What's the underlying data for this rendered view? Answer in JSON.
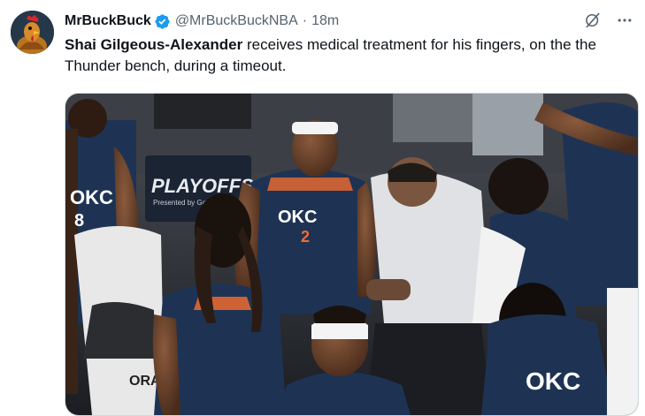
{
  "tweet": {
    "display_name": "MrBuckBuck",
    "handle": "@MrBuckBuckNBA",
    "separator": "·",
    "time": "18m",
    "text_bold": "Shai Gilgeous-Alexander",
    "text_rest": " receives medical treatment for his fingers, on the the Thunder bench, during a timeout."
  },
  "icons": {
    "verified": "verified-badge-icon",
    "grok": "grok-icon",
    "more": "more-options-icon"
  },
  "media": {
    "sign_text": "PLAYOFFS",
    "sign_sub": "Presented by Goo",
    "jersey_team": "OKC",
    "jersey_number_left": "8",
    "jersey_number_center": "2",
    "towel_text": "ORA"
  },
  "colors": {
    "verified": "#1d9bf0",
    "text_primary": "#0f1419",
    "text_secondary": "#536471",
    "thunder_navy": "#1e3354",
    "thunder_orange": "#ef6b30"
  }
}
